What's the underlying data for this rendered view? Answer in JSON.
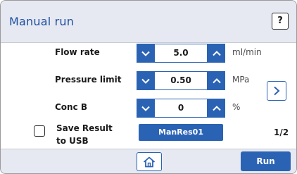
{
  "header": {
    "title": "Manual  run",
    "help_label": "?"
  },
  "parameters": [
    {
      "label": "Flow rate",
      "value": "5.0",
      "unit": "ml/min"
    },
    {
      "label": "Pressure limit",
      "value": "0.50",
      "unit": "MPa"
    },
    {
      "label": "Conc B",
      "value": "0",
      "unit": "%"
    }
  ],
  "save": {
    "label_line1": "Save Result",
    "label_line2": "to USB",
    "checked": false,
    "result_name": "ManRes01"
  },
  "pagination": {
    "indicator": "1/2"
  },
  "footer": {
    "run_label": "Run"
  },
  "icons": {
    "decrement": "chevron-down-icon",
    "increment": "chevron-up-icon",
    "next": "chevron-right-icon",
    "home": "home-icon"
  },
  "colors": {
    "accent": "#2b63b4",
    "header_bg": "#e6e9f2",
    "title": "#1f4fa0"
  }
}
